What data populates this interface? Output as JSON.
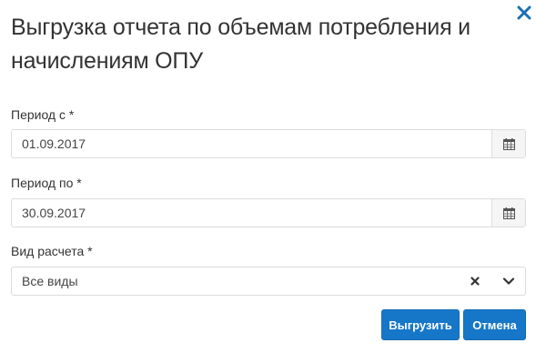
{
  "dialog": {
    "title": "Выгрузка отчета по объемам потребления и начислениям ОПУ"
  },
  "fields": {
    "period_from": {
      "label": "Период с *",
      "value": "01.09.2017"
    },
    "period_to": {
      "label": "Период по *",
      "value": "30.09.2017"
    },
    "calc_type": {
      "label": "Вид расчета *",
      "value": "Все виды"
    }
  },
  "actions": {
    "export_label": "Выгрузить",
    "cancel_label": "Отмена"
  },
  "icons": {
    "close": "close-icon",
    "calendar": "calendar-icon",
    "clear": "clear-icon",
    "chevron": "chevron-down-icon"
  },
  "colors": {
    "accent": "#1677c9",
    "close_icon": "#1a6fb5"
  }
}
